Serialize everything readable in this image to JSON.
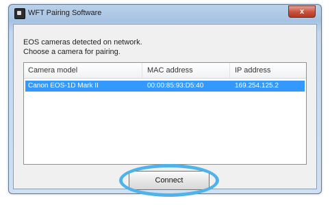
{
  "window": {
    "title": "WFT Pairing Software",
    "close_label": "x"
  },
  "instructions": {
    "line1": "EOS cameras detected on network.",
    "line2": "Choose a camera for pairing."
  },
  "table": {
    "headers": [
      "Camera model",
      "MAC address",
      "IP address"
    ],
    "rows": [
      [
        "Canon EOS-1D Mark II",
        "00:00:85:93:D5:40",
        "169.254.125.2"
      ]
    ]
  },
  "buttons": {
    "connect_label": "Connect"
  },
  "colors": {
    "selection": "#3399ff",
    "highlight_ring": "#4fb3e9"
  }
}
